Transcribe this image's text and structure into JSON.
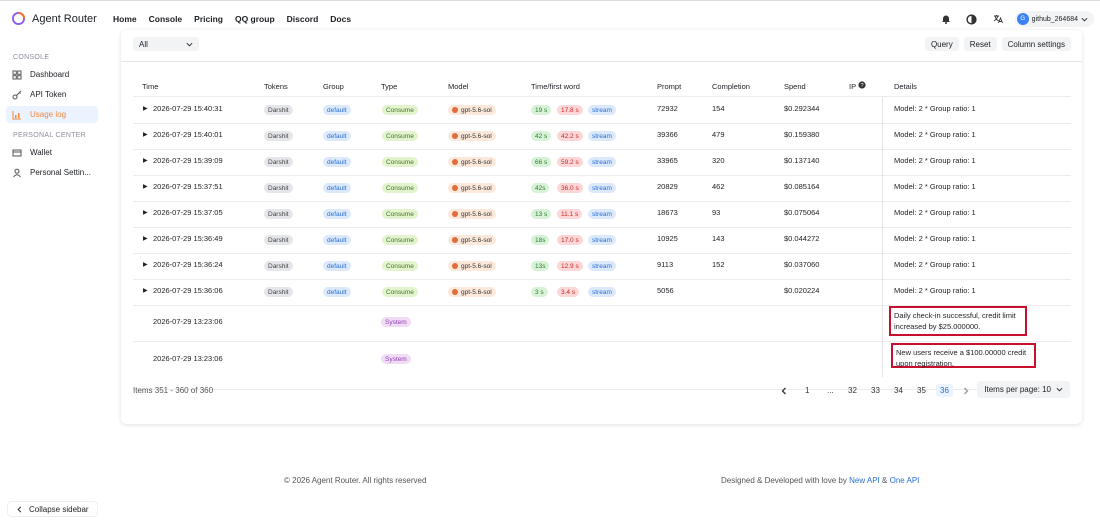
{
  "brand": "Agent Router",
  "nav": [
    "Home",
    "Console",
    "Pricing",
    "QQ group",
    "Discord",
    "Docs"
  ],
  "user": {
    "initial": "G",
    "name": "github_264684"
  },
  "sidebar": {
    "console_title": "CONSOLE",
    "items": [
      "Dashboard",
      "API Token",
      "Usage log"
    ],
    "personal_title": "PERSONAL CENTER",
    "personal_items": [
      "Wallet",
      "Personal Settin..."
    ],
    "collapse": "Collapse sidebar"
  },
  "filter": {
    "value": "All"
  },
  "toolbar": {
    "query": "Query",
    "reset": "Reset",
    "columns": "Column settings"
  },
  "columns": [
    "Time",
    "Tokens",
    "Group",
    "Type",
    "Model",
    "Time/first word",
    "Prompt",
    "Completion",
    "Spend",
    "IP",
    "Details"
  ],
  "rows": [
    {
      "time": "2026-07-29 15:40:31",
      "token": "Darshit",
      "group": "default",
      "type": "Consume",
      "model": "gpt-5.6-sol",
      "t1": "19 s",
      "t2": "17.8 s",
      "stream": "stream",
      "prompt": "72932",
      "completion": "154",
      "spend": "$0.292344",
      "details": "Model: 2 * Group ratio: 1"
    },
    {
      "time": "2026-07-29 15:40:01",
      "token": "Darshit",
      "group": "default",
      "type": "Consume",
      "model": "gpt-5.6-sol",
      "t1": "42 s",
      "t2": "42.2 s",
      "stream": "stream",
      "prompt": "39366",
      "completion": "479",
      "spend": "$0.159380",
      "details": "Model: 2 * Group ratio: 1"
    },
    {
      "time": "2026-07-29 15:39:09",
      "token": "Darshit",
      "group": "default",
      "type": "Consume",
      "model": "gpt-5.6-sol",
      "t1": "66 s",
      "t2": "59.2 s",
      "stream": "stream",
      "prompt": "33965",
      "completion": "320",
      "spend": "$0.137140",
      "details": "Model: 2 * Group ratio: 1"
    },
    {
      "time": "2026-07-29 15:37:51",
      "token": "Darshit",
      "group": "default",
      "type": "Consume",
      "model": "gpt-5.6-sol",
      "t1": "42s",
      "t2": "36.0 s",
      "stream": "stream",
      "prompt": "20829",
      "completion": "462",
      "spend": "$0.085164",
      "details": "Model: 2 * Group ratio: 1"
    },
    {
      "time": "2026-07-29 15:37:05",
      "token": "Darshit",
      "group": "default",
      "type": "Consume",
      "model": "gpt-5.6-sol",
      "t1": "13 s",
      "t2": "11.1 s",
      "stream": "stream",
      "prompt": "18673",
      "completion": "93",
      "spend": "$0.075064",
      "details": "Model: 2 * Group ratio: 1"
    },
    {
      "time": "2026-07-29 15:36:49",
      "token": "Darshit",
      "group": "default",
      "type": "Consume",
      "model": "gpt-5.6-sol",
      "t1": "18s",
      "t2": "17.0 s",
      "stream": "stream",
      "prompt": "10925",
      "completion": "143",
      "spend": "$0.044272",
      "details": "Model: 2 * Group ratio: 1"
    },
    {
      "time": "2026-07-29 15:36:24",
      "token": "Darshit",
      "group": "default",
      "type": "Consume",
      "model": "gpt-5.6-sol",
      "t1": "13s",
      "t2": "12.9 s",
      "stream": "stream",
      "prompt": "9113",
      "completion": "152",
      "spend": "$0.037060",
      "details": "Model: 2 * Group ratio: 1"
    },
    {
      "time": "2026-07-29 15:36:06",
      "token": "Darshit",
      "group": "default",
      "type": "Consume",
      "model": "gpt-5.6-sol",
      "t1": "3 s",
      "t2": "3.4 s",
      "stream": "stream",
      "prompt": "5056",
      "completion": "",
      "spend": "$0.020224",
      "details": "Model: 2 * Group ratio: 1"
    }
  ],
  "system_rows": [
    {
      "time": "2026-07-29 13:23:06",
      "type": "System",
      "details": "Daily check-in successful, credit limit increased by $25.000000."
    },
    {
      "time": "2026-07-29 13:23:06",
      "type": "System",
      "details": "New users receive a $100.00000 credit upon registration."
    }
  ],
  "pagination": {
    "summary": "Items 351 - 360 of 360",
    "pages": [
      "1",
      "...",
      "32",
      "33",
      "34",
      "35",
      "36"
    ],
    "per_page": "Items per page: 10"
  },
  "footer": {
    "copyright": "© 2026 Agent Router. All rights reserved",
    "designed": "Designed & Developed with love by",
    "link1": "New API",
    "amp": "&",
    "link2": "One API"
  },
  "colors": {
    "accent": "#f0883e",
    "link": "#2a6fd6",
    "highlight": "#c8102e"
  }
}
